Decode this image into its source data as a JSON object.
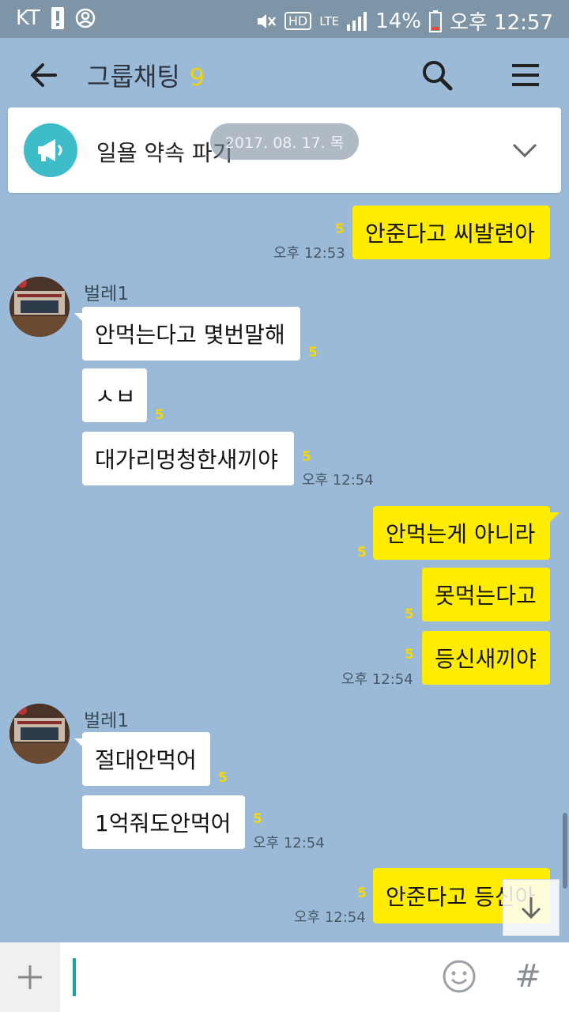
{
  "status_bar": {
    "carrier": "KT",
    "network": "LTE",
    "hd_label": "HD",
    "battery": "14%",
    "time": "오후 12:57"
  },
  "header": {
    "title": "그룹채팅",
    "member_count": "9"
  },
  "notice": {
    "text": "일욜 약속 파기",
    "date": "2017. 08. 17. 목"
  },
  "messages": [
    {
      "text": "안준다고 씨발련아",
      "unread": "5",
      "time": "오후 12:53"
    },
    {
      "sender": "벌레1",
      "text": "안먹는다고 몇번말해",
      "unread": "5"
    },
    {
      "text": "ㅅㅂ",
      "unread": "5"
    },
    {
      "text": "대가리멍청한새끼야",
      "unread": "5",
      "time": "오후 12:54"
    },
    {
      "text": "안먹는게 아니라",
      "unread": "5"
    },
    {
      "text": "못먹는다고",
      "unread": "5"
    },
    {
      "text": "등신새끼야",
      "unread": "5",
      "time": "오후 12:54"
    },
    {
      "sender": "벌레1",
      "text": "절대안먹어",
      "unread": "5"
    },
    {
      "text": "1억줘도안먹어",
      "unread": "5",
      "time": "오후 12:54"
    },
    {
      "text": "안준다고 등신아",
      "unread": "5",
      "time": "오후 12:54"
    }
  ],
  "input": {
    "placeholder": "",
    "hash_label": "#"
  },
  "colors": {
    "chat_bg": "#9bbad8",
    "outgoing_bubble": "#ffec00",
    "incoming_bubble": "#ffffff",
    "unread_count": "#f5d800",
    "notice_icon": "#3fbcc9"
  }
}
